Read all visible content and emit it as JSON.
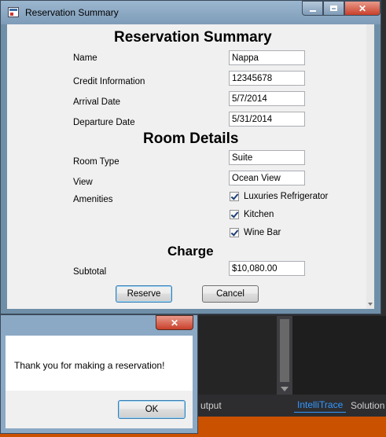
{
  "window": {
    "title": "Reservation Summary",
    "close_glyph": "✕"
  },
  "form": {
    "heading": "Reservation Summary",
    "name_label": "Name",
    "name_value": "Nappa",
    "credit_label": "Credit Information",
    "credit_value": "12345678",
    "arrival_label": "Arrival Date",
    "arrival_value": "5/7/2014",
    "departure_label": "Departure Date",
    "departure_value": "5/31/2014",
    "room_heading": "Room Details",
    "room_type_label": "Room Type",
    "room_type_value": "Suite",
    "view_label": "View",
    "view_value": "Ocean View",
    "amenities_label": "Amenities",
    "amenities": [
      {
        "label": "Luxuries Refrigerator",
        "checked": true
      },
      {
        "label": "Kitchen",
        "checked": true
      },
      {
        "label": "Wine Bar",
        "checked": true
      }
    ],
    "charge_heading": "Charge",
    "subtotal_label": "Subtotal",
    "subtotal_value": "$10,080.00",
    "reserve_label": "Reserve",
    "cancel_label": "Cancel"
  },
  "message_box": {
    "text": "Thank you for making a reservation!",
    "ok_label": "OK",
    "close_glyph": "✕"
  },
  "ide": {
    "tab_output": "utput",
    "tab_intellitrace": "IntelliTrace",
    "tab_solution": "Solution",
    "status_color": "#ca5100"
  }
}
